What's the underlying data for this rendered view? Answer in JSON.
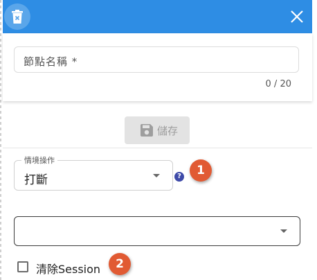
{
  "header": {
    "delete_icon": "trash-icon",
    "close_icon": "close-icon",
    "color": "#2e8de4"
  },
  "node_name": {
    "placeholder": "節點名稱 *",
    "value": "",
    "counter": "0 / 20"
  },
  "save_button": {
    "icon": "floppy-disk-icon",
    "label": "儲存"
  },
  "scenario_action": {
    "legend": "情境操作",
    "value": "打斷",
    "help_icon": "question-circle-icon",
    "help_glyph": "?"
  },
  "secondary_select": {
    "value": ""
  },
  "clear_session": {
    "label": "清除Session",
    "checked": false
  },
  "markers": {
    "first": "1",
    "second": "2",
    "color": "#e15a33"
  }
}
